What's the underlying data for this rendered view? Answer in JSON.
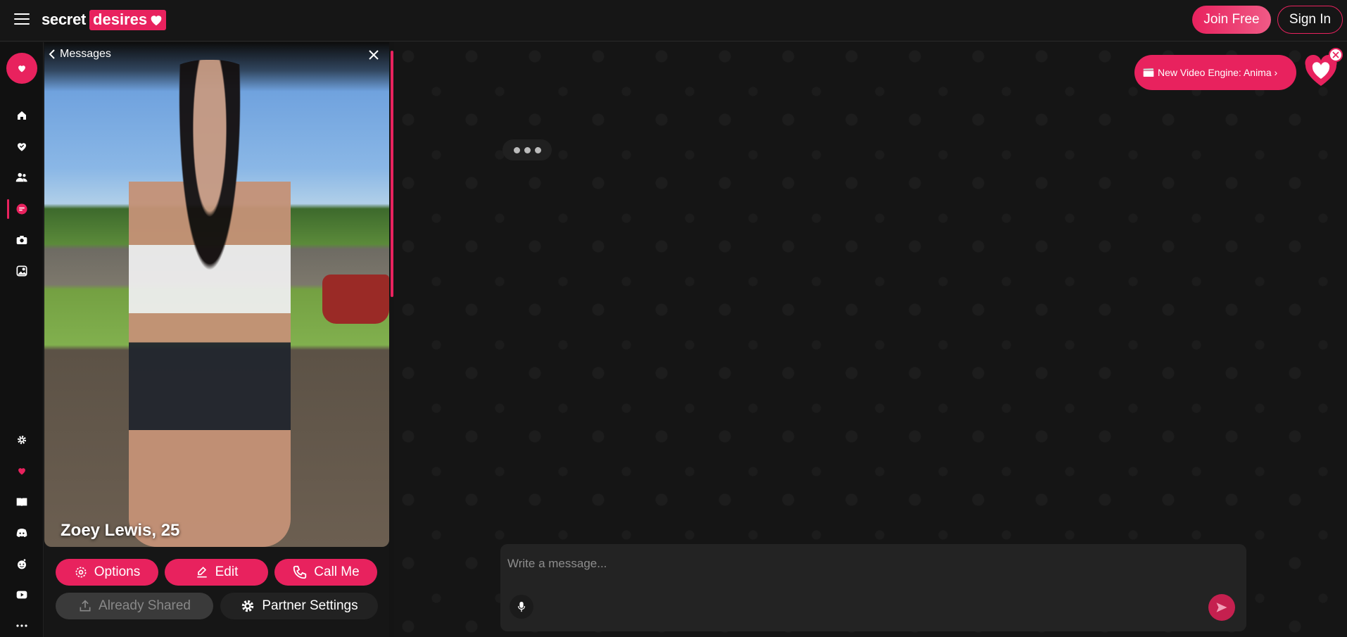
{
  "brand": {
    "word1": "secret",
    "word2": "desires",
    "accent": "#e8225e"
  },
  "header": {
    "join_label": "Join Free",
    "signin_label": "Sign In"
  },
  "nav": {
    "top": [
      "home-icon",
      "heart-check-icon",
      "users-icon",
      "chat-icon",
      "camera-icon",
      "gallery-icon"
    ],
    "bottom": [
      "gear-icon",
      "heart-icon",
      "book-icon",
      "discord-icon",
      "reddit-icon",
      "video-icon",
      "more-icon"
    ],
    "active": "chat-icon"
  },
  "profile": {
    "back_label": "Messages",
    "name": "Zoey Lewis, 25",
    "buttons": {
      "options": "Options",
      "edit": "Edit",
      "call": "Call Me",
      "shared": "Already Shared",
      "partner": "Partner Settings"
    }
  },
  "chat": {
    "promo": "New Video Engine: Anima ›",
    "composer_placeholder": "Write a message..."
  }
}
